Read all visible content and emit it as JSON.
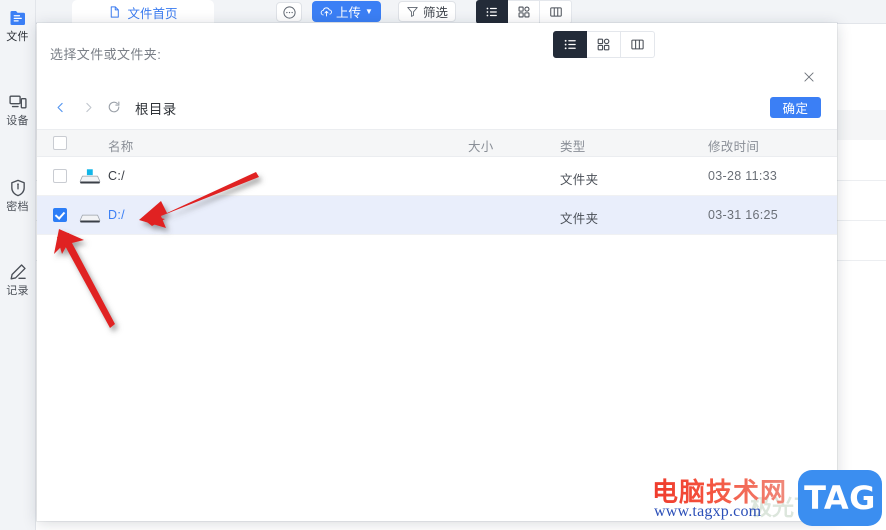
{
  "sidebar": {
    "items": [
      {
        "label": "文件",
        "icon": "files-icon",
        "active": true
      },
      {
        "label": "设备",
        "icon": "devices-icon",
        "active": false
      },
      {
        "label": "密档",
        "icon": "shield-lock-icon",
        "active": false
      },
      {
        "label": "记录",
        "icon": "pencil-record-icon",
        "active": false
      }
    ]
  },
  "topbar": {
    "tab_label": "文件首页",
    "tab_icon": "document-icon",
    "more_button": "...",
    "upload_label": "上传",
    "upload_icon": "cloud-upload-icon",
    "upload_caret": "▼",
    "filter_label": "筛选",
    "filter_icon": "funnel-icon",
    "views": [
      {
        "name": "list-view",
        "active": true
      },
      {
        "name": "grid-view",
        "active": false
      },
      {
        "name": "column-view",
        "active": false
      }
    ]
  },
  "dialog": {
    "title": "选择文件或文件夹:",
    "close_icon": "close-icon",
    "views": [
      {
        "name": "list-view",
        "active": true
      },
      {
        "name": "grid-view",
        "active": false
      },
      {
        "name": "column-view",
        "active": false
      }
    ],
    "nav": {
      "back_icon": "chevron-left-icon",
      "forward_icon": "chevron-right-icon",
      "refresh_icon": "refresh-icon",
      "breadcrumb": "根目录",
      "confirm_label": "确定"
    },
    "table": {
      "columns": [
        "名称",
        "大小",
        "类型",
        "修改时间"
      ],
      "select_all_checked": false,
      "rows": [
        {
          "name": "C:/",
          "size": "",
          "type": "文件夹",
          "modified": "03-28 11:33",
          "checked": false,
          "selected": false,
          "icon": "system-drive-icon"
        },
        {
          "name": "D:/",
          "size": "",
          "type": "文件夹",
          "modified": "03-31 16:25",
          "checked": true,
          "selected": true,
          "icon": "drive-icon"
        }
      ]
    }
  },
  "watermark": {
    "site_cn": "电脑技术网",
    "url": "www.tagxp.com",
    "logo": "TAG",
    "ghost_text": "极光下载站"
  },
  "colors": {
    "accent_blue": "#3b7ff5",
    "link_blue": "#3a7bf0",
    "row_selected": "#e9eefb",
    "dark_toggle": "#232b38",
    "annotation_red": "#e02020",
    "sidebar_bg": "#f2f4f7"
  },
  "annotations": {
    "arrow_to_row": "arrow-pointing-to-d-drive-row",
    "arrow_to_checkbox": "arrow-pointing-to-d-drive-checkbox"
  }
}
